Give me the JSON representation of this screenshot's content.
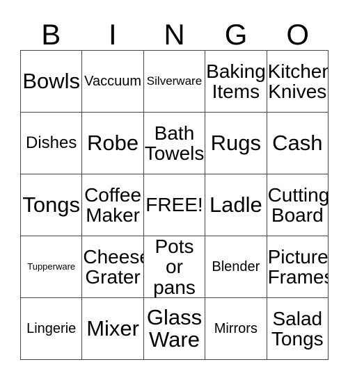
{
  "card": {
    "header_letters": [
      "B",
      "I",
      "N",
      "G",
      "O"
    ],
    "rows": [
      [
        {
          "label": "Bowls",
          "size": "fs-xl"
        },
        {
          "label": "Vaccuum",
          "size": "fs-sm"
        },
        {
          "label": "Silverware",
          "size": "fs-xs"
        },
        {
          "label": "Baking\nItems",
          "size": "fs-lg"
        },
        {
          "label": "Kitchen\nKnives",
          "size": "fs-lg"
        }
      ],
      [
        {
          "label": "Dishes",
          "size": "fs-md"
        },
        {
          "label": "Robe",
          "size": "fs-xl"
        },
        {
          "label": "Bath\nTowels",
          "size": "fs-lg"
        },
        {
          "label": "Rugs",
          "size": "fs-xl"
        },
        {
          "label": "Cash",
          "size": "fs-xl"
        }
      ],
      [
        {
          "label": "Tongs",
          "size": "fs-xl"
        },
        {
          "label": "Coffee\nMaker",
          "size": "fs-lg"
        },
        {
          "label": "FREE!",
          "size": "fs-lg"
        },
        {
          "label": "Ladle",
          "size": "fs-xl"
        },
        {
          "label": "Cutting\nBoard",
          "size": "fs-lg"
        }
      ],
      [
        {
          "label": "Tupperware",
          "size": "fs-xxs"
        },
        {
          "label": "Cheese\nGrater",
          "size": "fs-lg"
        },
        {
          "label": "Pots or\npans",
          "size": "fs-lg"
        },
        {
          "label": "Blender",
          "size": "fs-sm"
        },
        {
          "label": "Picture\nFrames",
          "size": "fs-lg"
        }
      ],
      [
        {
          "label": "Lingerie",
          "size": "fs-sm"
        },
        {
          "label": "Mixer",
          "size": "fs-xl"
        },
        {
          "label": "Glass\nWare",
          "size": "fs-xl"
        },
        {
          "label": "Mirrors",
          "size": "fs-sm"
        },
        {
          "label": "Salad\nTongs",
          "size": "fs-lg"
        }
      ]
    ],
    "free_space": "FREE!",
    "colors": {
      "text": "#000000",
      "border": "#444444",
      "background": "#ffffff"
    }
  }
}
